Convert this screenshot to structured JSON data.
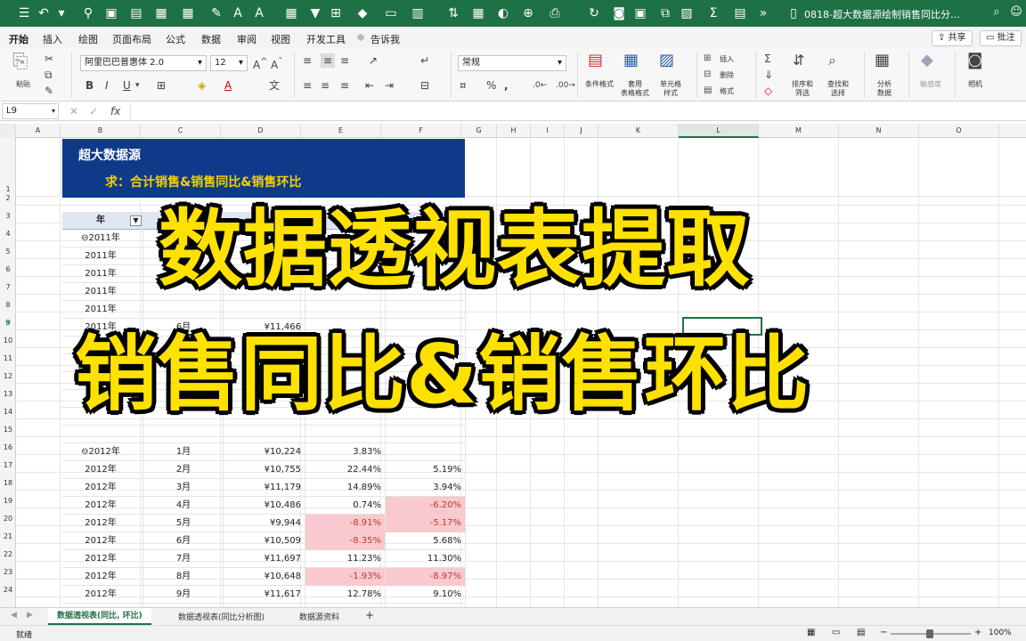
{
  "titlebar": {
    "document_title": "0818-超大数据源绘制销售同比分…",
    "icons": [
      "sidebar-icon",
      "home-icon",
      "undo-icon",
      "redo-icon",
      "filter-icon",
      "sort-icon",
      "bold-icon",
      "grid-icon",
      "chart-icon",
      "font-size-up-icon",
      "font-size-down-icon",
      "table-icon",
      "sum-icon",
      "funnel-icon",
      "format-icon",
      "fill-icon",
      "color-icon",
      "merge-icon",
      "zoom-icon",
      "search-icon",
      "print-icon",
      "refresh-icon",
      "more-icon"
    ]
  },
  "ribbon_tabs": [
    "开始",
    "插入",
    "绘图",
    "页面布局",
    "公式",
    "数据",
    "审阅",
    "视图",
    "开发工具",
    "告诉我"
  ],
  "ribbon_buttons": {
    "share": "共享",
    "comments": "批注"
  },
  "ribbon": {
    "paste_label": "粘贴",
    "font_name": "阿里巴巴普惠体 2.0",
    "font_size": "12",
    "font_buttons": [
      "B",
      "I",
      "U"
    ],
    "number_format": "常规",
    "percent_symbol": "%",
    "groups": [
      {
        "label": "条件格式"
      },
      {
        "label": "套用\n表格格式"
      },
      {
        "label": "单元格\n样式"
      },
      {
        "label": "插入"
      },
      {
        "label": "删除"
      },
      {
        "label": "格式"
      },
      {
        "label": "排序和\n筛选"
      },
      {
        "label": "查找和\n选择"
      },
      {
        "label": "分析\n数据"
      },
      {
        "label": "敏感度"
      },
      {
        "label": "相机"
      }
    ]
  },
  "formulabar": {
    "name_box": "L9",
    "fx": "fx",
    "cancel": "✕",
    "confirm": "✓"
  },
  "columns": [
    "A",
    "B",
    "C",
    "D",
    "E",
    "F",
    "G",
    "H",
    "I",
    "J",
    "K",
    "L",
    "M",
    "N",
    "O"
  ],
  "rows": [
    "1",
    "2",
    "3",
    "4",
    "5",
    "6",
    "7",
    "8",
    "9",
    "10",
    "11",
    "12",
    "13",
    "14",
    "15",
    "16",
    "17",
    "18",
    "19",
    "20",
    "21",
    "22",
    "23",
    "24"
  ],
  "banner": {
    "title": "超大数据源",
    "subtitle": "求：合计销售&销售同比&销售环比"
  },
  "pivot": {
    "header_year": "年",
    "rows": [
      {
        "year": "⊖2011年",
        "month": "",
        "sales": "",
        "yoy": "",
        "mom": "",
        "yoy_neg": false,
        "mom_neg": false
      },
      {
        "year": "2011年",
        "month": "",
        "sales": "",
        "yoy": "",
        "mom": "",
        "yoy_neg": false,
        "mom_neg": false
      },
      {
        "year": "2011年",
        "month": "",
        "sales": "",
        "yoy": "",
        "mom": "",
        "yoy_neg": false,
        "mom_neg": false
      },
      {
        "year": "2011年",
        "month": "",
        "sales": "",
        "yoy": "",
        "mom": "",
        "yoy_neg": false,
        "mom_neg": false
      },
      {
        "year": "2011年",
        "month": "",
        "sales": "",
        "yoy": "",
        "mom": "",
        "yoy_neg": false,
        "mom_neg": false
      },
      {
        "year": "2011年",
        "month": "6月",
        "sales": "¥11,466",
        "yoy": "",
        "mom": "",
        "yoy_neg": false,
        "mom_neg": false
      },
      {
        "year": "",
        "month": "",
        "sales": "",
        "yoy": "",
        "mom": "",
        "yoy_neg": false,
        "mom_neg": false
      },
      {
        "year": "",
        "month": "",
        "sales": "",
        "yoy": "",
        "mom": "",
        "yoy_neg": false,
        "mom_neg": false
      },
      {
        "year": "",
        "month": "",
        "sales": "",
        "yoy": "",
        "mom": "",
        "yoy_neg": false,
        "mom_neg": false
      },
      {
        "year": "",
        "month": "",
        "sales": "",
        "yoy": "",
        "mom": "",
        "yoy_neg": false,
        "mom_neg": false
      },
      {
        "year": "",
        "month": "",
        "sales": "",
        "yoy": "",
        "mom": "",
        "yoy_neg": false,
        "mom_neg": false
      },
      {
        "year": "",
        "month": "",
        "sales": "",
        "yoy": "",
        "mom": "",
        "yoy_neg": false,
        "mom_neg": false
      },
      {
        "year": "⊖2012年",
        "month": "1月",
        "sales": "¥10,224",
        "yoy": "3.83%",
        "mom": "",
        "yoy_neg": false,
        "mom_neg": false
      },
      {
        "year": "2012年",
        "month": "2月",
        "sales": "¥10,755",
        "yoy": "22.44%",
        "mom": "5.19%",
        "yoy_neg": false,
        "mom_neg": false
      },
      {
        "year": "2012年",
        "month": "3月",
        "sales": "¥11,179",
        "yoy": "14.89%",
        "mom": "3.94%",
        "yoy_neg": false,
        "mom_neg": false
      },
      {
        "year": "2012年",
        "month": "4月",
        "sales": "¥10,486",
        "yoy": "0.74%",
        "mom": "-6.20%",
        "yoy_neg": false,
        "mom_neg": true
      },
      {
        "year": "2012年",
        "month": "5月",
        "sales": "¥9,944",
        "yoy": "-8.91%",
        "mom": "-5.17%",
        "yoy_neg": true,
        "mom_neg": true
      },
      {
        "year": "2012年",
        "month": "6月",
        "sales": "¥10,509",
        "yoy": "-8.35%",
        "mom": "5.68%",
        "yoy_neg": true,
        "mom_neg": false
      },
      {
        "year": "2012年",
        "month": "7月",
        "sales": "¥11,697",
        "yoy": "11.23%",
        "mom": "11.30%",
        "yoy_neg": false,
        "mom_neg": false
      },
      {
        "year": "2012年",
        "month": "8月",
        "sales": "¥10,648",
        "yoy": "-1.93%",
        "mom": "-8.97%",
        "yoy_neg": true,
        "mom_neg": true
      },
      {
        "year": "2012年",
        "month": "9月",
        "sales": "¥11,617",
        "yoy": "12.78%",
        "mom": "9.10%",
        "yoy_neg": false,
        "mom_neg": false
      }
    ]
  },
  "overlay": {
    "line1": "数据透视表提取",
    "line2": "销售同比&销售环比"
  },
  "sheet_tabs": [
    "数据透视表(同比, 环比)",
    "数据透视表(同比分析图)",
    "数据源资料"
  ],
  "add_sheet": "+",
  "status": {
    "ready": "就绪",
    "zoom": "100%",
    "zoom_minus": "−",
    "zoom_plus": "+"
  },
  "colors": {
    "excel_green": "#1e7145",
    "banner_blue": "#0f3a8a",
    "banner_yellow": "#f5d000",
    "overlay_yellow": "#ffe100",
    "neg_pink": "#f8c9cf",
    "neg_red": "#c0392b"
  }
}
